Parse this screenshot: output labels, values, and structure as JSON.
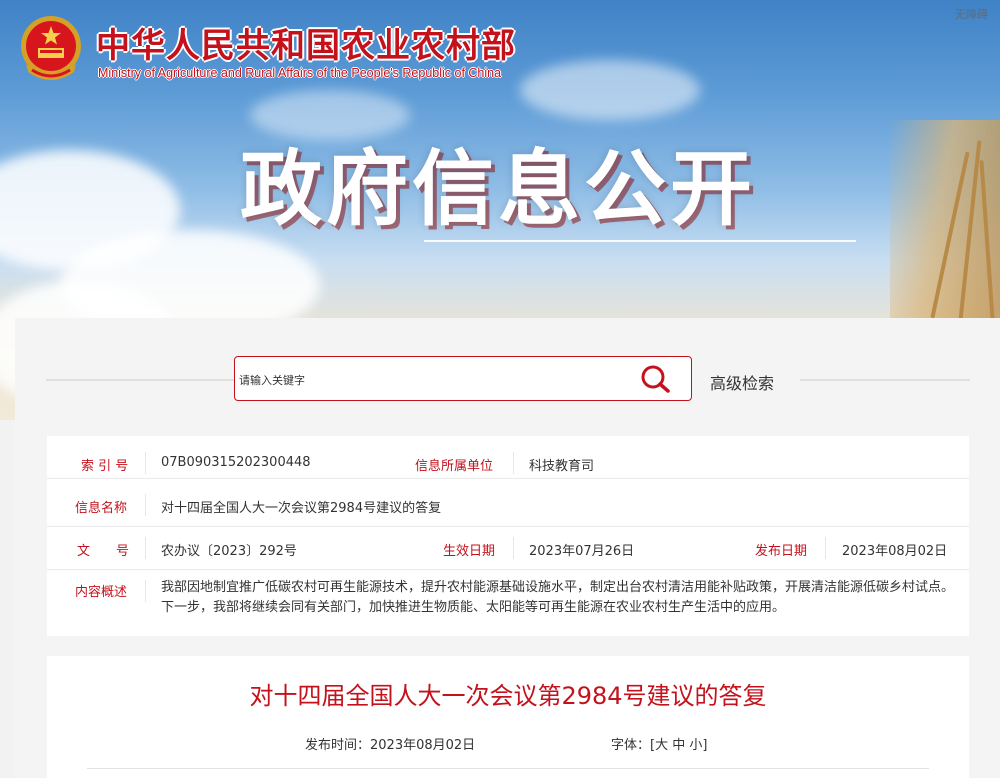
{
  "header": {
    "site_name_cn": "中华人民共和国农业农村部",
    "site_name_en": "Ministry of Agriculture and Rural Affairs of the People's Republic of China",
    "accessibility_link": "无障碍",
    "hero_title": "政府信息公开",
    "emblem_icon": "national-emblem-icon"
  },
  "search": {
    "placeholder": "请输入关键字",
    "advanced_label": "高级检索"
  },
  "info": {
    "index_label": "索 引 号",
    "index_value": "07B090315202300448",
    "org_label": "信息所属单位",
    "org_value": "科技教育司",
    "name_label": "信息名称",
    "name_value": "对十四届全国人大一次会议第2984号建议的答复",
    "doc_label": "文　　号",
    "doc_value": "农办议〔2023〕292号",
    "effective_label": "生效日期",
    "effective_value": "2023年07月26日",
    "publish_label": "发布日期",
    "publish_value": "2023年08月02日",
    "summary_label": "内容概述",
    "summary_value": "我部因地制宜推广低碳农村可再生能源技术，提升农村能源基础设施水平，制定出台农村清洁用能补贴政策，开展清洁能源低碳乡村试点。下一步，我部将继续会同有关部门，加快推进生物质能、太阳能等可再生能源在农业农村生产生活中的应用。"
  },
  "article": {
    "title": "对十四届全国人大一次会议第2984号建议的答复",
    "publish_time_label": "发布时间：",
    "publish_time_value": "2023年08月02日",
    "font_label": "字体：",
    "font_open": "[",
    "font_large": "大",
    "font_medium": "中",
    "font_small": "小",
    "font_close": "]"
  },
  "colors": {
    "brand_red": "#c4121c"
  }
}
